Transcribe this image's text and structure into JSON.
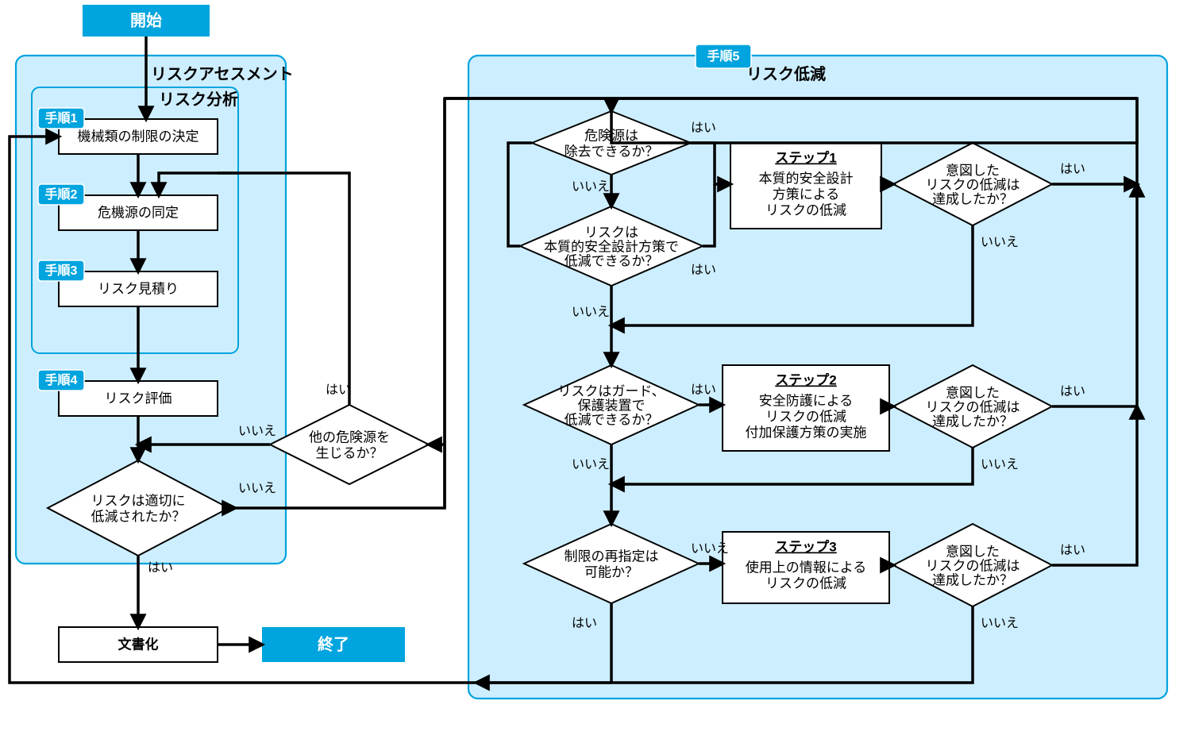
{
  "terminals": {
    "start": "開始",
    "end": "終了"
  },
  "groups": {
    "assessment_title": "リスクアセスメント",
    "analysis_title": "リスク分析",
    "reduction_title": "リスク低減"
  },
  "badges": {
    "p1": "手順1",
    "p2": "手順2",
    "p3": "手順3",
    "p4": "手順4",
    "p5": "手順5"
  },
  "proc": {
    "p1": "機械類の制限の決定",
    "p2": "危機源の同定",
    "p3": "リスク見積り",
    "p4": "リスク評価",
    "doc": "文書化"
  },
  "steps": {
    "s1_head": "ステップ1",
    "s1_body1": "本質的安全設計",
    "s1_body2": "方策による",
    "s1_body3": "リスクの低減",
    "s2_head": "ステップ2",
    "s2_body1": "安全防護による",
    "s2_body2": "リスクの低減",
    "s2_body3": "付加保護方策の実施",
    "s3_head": "ステップ3",
    "s3_body1": "使用上の情報による",
    "s3_body2": "リスクの低減"
  },
  "dec": {
    "reduced1": "リスクは適切に",
    "reduced2": "低減されたか？",
    "other1": "他の危険源を",
    "other2": "生じるか？",
    "remove1": "危険源は",
    "remove2": "除去できるか？",
    "inh1": "リスクは",
    "inh2": "本質的安全設計方策で",
    "inh3": "低減できるか？",
    "guard1": "リスクはガード、",
    "guard2": "保護装置で",
    "guard3": "低減できるか？",
    "relim1": "制限の再指定は",
    "relim2": "可能か？",
    "ach1": "意図した",
    "ach2": "リスクの低減は",
    "ach3": "達成したか？"
  },
  "ans": {
    "yes": "はい",
    "no": "いいえ"
  }
}
